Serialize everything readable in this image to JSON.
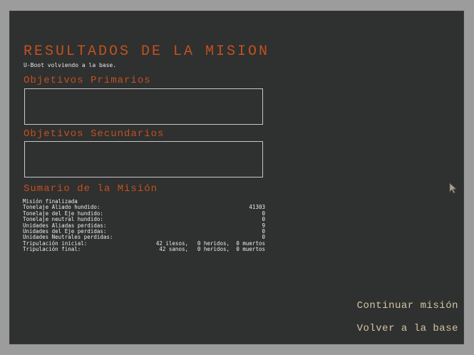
{
  "header": {
    "title": "RESULTADOS DE LA MISION",
    "subtitle": "U-Boot volviendo a la base."
  },
  "primary_objectives": {
    "title": "Objetivos Primarios",
    "content": ""
  },
  "secondary_objectives": {
    "title": "Objetivos Secundarios",
    "content": ""
  },
  "summary": {
    "title": "Sumario de la Misión",
    "status": "Misión finalizada",
    "rows": [
      {
        "label": "Tonelaje Aliado hundido:",
        "value": "41303"
      },
      {
        "label": "Tonelaje del Eje hundido:",
        "value": "0"
      },
      {
        "label": "Tonelaje neutral hundido:",
        "value": "0"
      },
      {
        "label": "Unidades Aliadas perdidas:",
        "value": "9"
      },
      {
        "label": "Unidades del Eje perdidas:",
        "value": "0"
      },
      {
        "label": "Unidades Neutrales perdidas:",
        "value": "0"
      }
    ],
    "crew_initial": {
      "label": "Tripulación inicial:",
      "unharmed": "42 ilesos,",
      "wounded": "0 heridos,",
      "dead": "0 muertos"
    },
    "crew_final": {
      "label": "Tripulación final:",
      "unharmed": "42 sanos,",
      "wounded": "0 heridos,",
      "dead": "0 muertos"
    }
  },
  "menu": {
    "continue_label": "Continuar misión",
    "return_label": "Volver a la base"
  },
  "colors": {
    "accent": "#c2521e",
    "menu_text": "#d4c6a2",
    "background": "#2f3030",
    "frame": "#9c9c9c"
  },
  "icons": {
    "cursor": "mouse-pointer-icon"
  }
}
